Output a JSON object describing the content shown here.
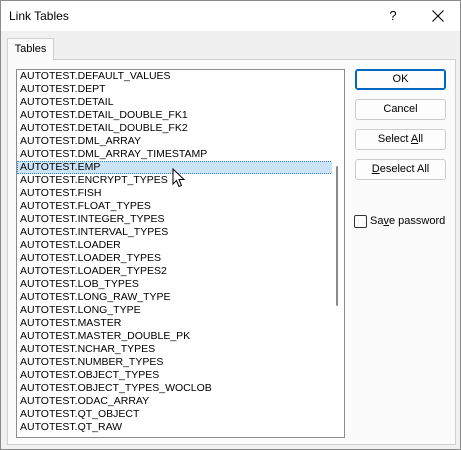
{
  "window": {
    "title": "Link Tables"
  },
  "titlebar": {
    "help_label": "?"
  },
  "tabs": [
    {
      "label": "Tables"
    }
  ],
  "tables": {
    "items": [
      "AUTOTEST.DEFAULT_VALUES",
      "AUTOTEST.DEPT",
      "AUTOTEST.DETAIL",
      "AUTOTEST.DETAIL_DOUBLE_FK1",
      "AUTOTEST.DETAIL_DOUBLE_FK2",
      "AUTOTEST.DML_ARRAY",
      "AUTOTEST.DML_ARRAY_TIMESTAMP",
      "AUTOTEST.EMP",
      "AUTOTEST.ENCRYPT_TYPES",
      "AUTOTEST.FISH",
      "AUTOTEST.FLOAT_TYPES",
      "AUTOTEST.INTEGER_TYPES",
      "AUTOTEST.INTERVAL_TYPES",
      "AUTOTEST.LOADER",
      "AUTOTEST.LOADER_TYPES",
      "AUTOTEST.LOADER_TYPES2",
      "AUTOTEST.LOB_TYPES",
      "AUTOTEST.LONG_RAW_TYPE",
      "AUTOTEST.LONG_TYPE",
      "AUTOTEST.MASTER",
      "AUTOTEST.MASTER_DOUBLE_PK",
      "AUTOTEST.NCHAR_TYPES",
      "AUTOTEST.NUMBER_TYPES",
      "AUTOTEST.OBJECT_TYPES",
      "AUTOTEST.OBJECT_TYPES_WOCLOB",
      "AUTOTEST.ODAC_ARRAY",
      "AUTOTEST.QT_OBJECT",
      "AUTOTEST.QT_RAW"
    ],
    "selected_item": "AUTOTEST.EMP"
  },
  "buttons": {
    "ok": "OK",
    "cancel": "Cancel",
    "select_all_pre": "Select ",
    "select_all_key": "A",
    "select_all_post": "ll",
    "deselect_all_pre": "",
    "deselect_all_key": "D",
    "deselect_all_post": "eselect All"
  },
  "save_password": {
    "label_pre": "Sa",
    "label_key": "v",
    "label_post": "e password",
    "checked": false
  },
  "colors": {
    "accent": "#0067c0",
    "selection": "#cce4f7"
  }
}
